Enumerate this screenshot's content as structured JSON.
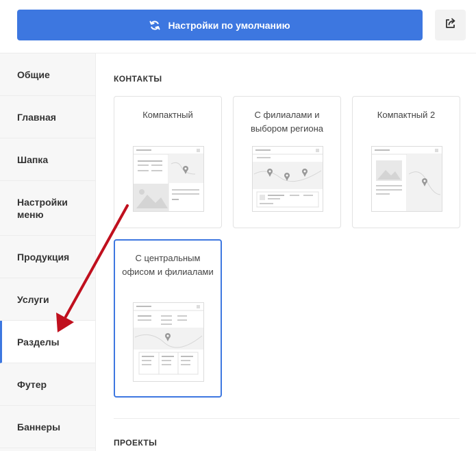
{
  "toolbar": {
    "reset_label": "Настройки по умолчанию",
    "reset_icon": "refresh-icon",
    "share_icon": "share-icon",
    "accent": "#3d77e0"
  },
  "sidebar": {
    "items": [
      {
        "label": "Общие"
      },
      {
        "label": "Главная"
      },
      {
        "label": "Шапка"
      },
      {
        "label": "Настройки меню"
      },
      {
        "label": "Продукция"
      },
      {
        "label": "Услуги"
      },
      {
        "label": "Разделы",
        "active": true
      },
      {
        "label": "Футер"
      },
      {
        "label": "Баннеры"
      }
    ]
  },
  "main": {
    "contacts_title": "КОНТАКТЫ",
    "cards": [
      {
        "title": "Компактный"
      },
      {
        "title": "С филиалами и выбором региона"
      },
      {
        "title": "Компактный 2"
      },
      {
        "title": "С центральным офисом и филиалами",
        "selected": true
      }
    ],
    "projects_title": "ПРОЕКТЫ"
  },
  "annotation": {
    "arrow_color": "#c0101e"
  }
}
